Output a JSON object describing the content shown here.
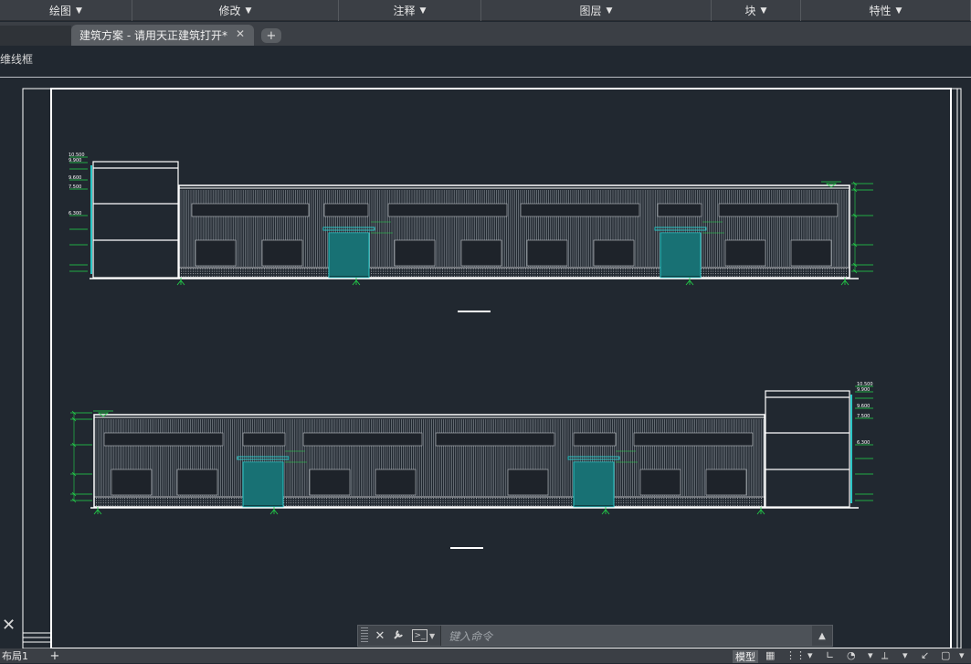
{
  "menubar": {
    "items": [
      {
        "label": "绘图",
        "width": 145
      },
      {
        "label": "修改",
        "width": 226
      },
      {
        "label": "注释",
        "width": 156
      },
      {
        "label": "图层",
        "width": 252
      },
      {
        "label": "块",
        "width": 98
      },
      {
        "label": "特性",
        "width": 186
      }
    ]
  },
  "tabs": {
    "document": "建筑方案 - 请用天正建筑打开*",
    "close_glyph": "✕",
    "new_glyph": "+"
  },
  "view": {
    "label": "维线框"
  },
  "command": {
    "placeholder": "键入命令",
    "close_glyph": "✕",
    "tools_glyph": "🔧",
    "expand_glyph": "▲"
  },
  "status": {
    "layout_tab": "布局1",
    "add_glyph": "+",
    "model_label": "模型"
  },
  "drawing": {
    "colors": {
      "background": "#212830",
      "frame": "#ffffff",
      "hatch": "#8f969e",
      "accent": "#29c6c6",
      "dim": "#22d84a"
    },
    "elevation_1": {
      "tower_levels": [
        "10.500",
        "9.900",
        "9.600",
        "7.500",
        "6.300"
      ]
    },
    "elevation_2": {
      "tower_levels": [
        "10.500",
        "9.900",
        "9.600",
        "7.500",
        "6.300"
      ]
    }
  }
}
